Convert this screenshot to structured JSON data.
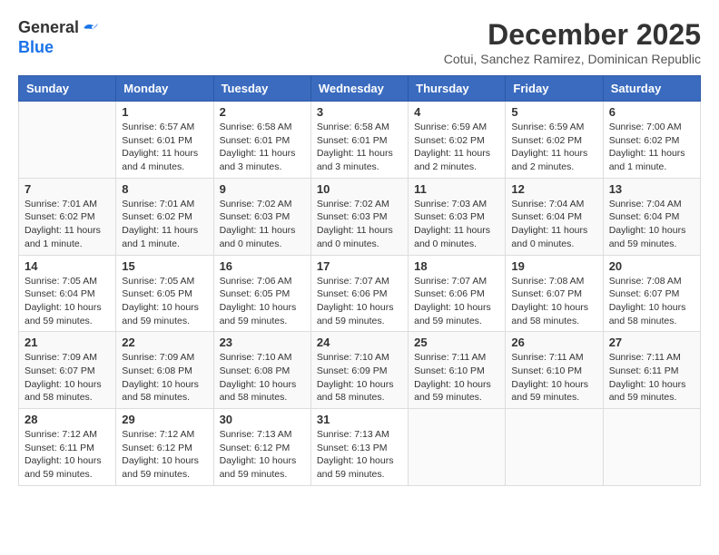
{
  "header": {
    "logo_line1": "General",
    "logo_line2": "Blue",
    "month_title": "December 2025",
    "subtitle": "Cotui, Sanchez Ramirez, Dominican Republic"
  },
  "columns": [
    "Sunday",
    "Monday",
    "Tuesday",
    "Wednesday",
    "Thursday",
    "Friday",
    "Saturday"
  ],
  "weeks": [
    [
      {
        "day": "",
        "info": ""
      },
      {
        "day": "1",
        "info": "Sunrise: 6:57 AM\nSunset: 6:01 PM\nDaylight: 11 hours\nand 4 minutes."
      },
      {
        "day": "2",
        "info": "Sunrise: 6:58 AM\nSunset: 6:01 PM\nDaylight: 11 hours\nand 3 minutes."
      },
      {
        "day": "3",
        "info": "Sunrise: 6:58 AM\nSunset: 6:01 PM\nDaylight: 11 hours\nand 3 minutes."
      },
      {
        "day": "4",
        "info": "Sunrise: 6:59 AM\nSunset: 6:02 PM\nDaylight: 11 hours\nand 2 minutes."
      },
      {
        "day": "5",
        "info": "Sunrise: 6:59 AM\nSunset: 6:02 PM\nDaylight: 11 hours\nand 2 minutes."
      },
      {
        "day": "6",
        "info": "Sunrise: 7:00 AM\nSunset: 6:02 PM\nDaylight: 11 hours\nand 1 minute."
      }
    ],
    [
      {
        "day": "7",
        "info": "Sunrise: 7:01 AM\nSunset: 6:02 PM\nDaylight: 11 hours\nand 1 minute."
      },
      {
        "day": "8",
        "info": "Sunrise: 7:01 AM\nSunset: 6:02 PM\nDaylight: 11 hours\nand 1 minute."
      },
      {
        "day": "9",
        "info": "Sunrise: 7:02 AM\nSunset: 6:03 PM\nDaylight: 11 hours\nand 0 minutes."
      },
      {
        "day": "10",
        "info": "Sunrise: 7:02 AM\nSunset: 6:03 PM\nDaylight: 11 hours\nand 0 minutes."
      },
      {
        "day": "11",
        "info": "Sunrise: 7:03 AM\nSunset: 6:03 PM\nDaylight: 11 hours\nand 0 minutes."
      },
      {
        "day": "12",
        "info": "Sunrise: 7:04 AM\nSunset: 6:04 PM\nDaylight: 11 hours\nand 0 minutes."
      },
      {
        "day": "13",
        "info": "Sunrise: 7:04 AM\nSunset: 6:04 PM\nDaylight: 10 hours\nand 59 minutes."
      }
    ],
    [
      {
        "day": "14",
        "info": "Sunrise: 7:05 AM\nSunset: 6:04 PM\nDaylight: 10 hours\nand 59 minutes."
      },
      {
        "day": "15",
        "info": "Sunrise: 7:05 AM\nSunset: 6:05 PM\nDaylight: 10 hours\nand 59 minutes."
      },
      {
        "day": "16",
        "info": "Sunrise: 7:06 AM\nSunset: 6:05 PM\nDaylight: 10 hours\nand 59 minutes."
      },
      {
        "day": "17",
        "info": "Sunrise: 7:07 AM\nSunset: 6:06 PM\nDaylight: 10 hours\nand 59 minutes."
      },
      {
        "day": "18",
        "info": "Sunrise: 7:07 AM\nSunset: 6:06 PM\nDaylight: 10 hours\nand 59 minutes."
      },
      {
        "day": "19",
        "info": "Sunrise: 7:08 AM\nSunset: 6:07 PM\nDaylight: 10 hours\nand 58 minutes."
      },
      {
        "day": "20",
        "info": "Sunrise: 7:08 AM\nSunset: 6:07 PM\nDaylight: 10 hours\nand 58 minutes."
      }
    ],
    [
      {
        "day": "21",
        "info": "Sunrise: 7:09 AM\nSunset: 6:07 PM\nDaylight: 10 hours\nand 58 minutes."
      },
      {
        "day": "22",
        "info": "Sunrise: 7:09 AM\nSunset: 6:08 PM\nDaylight: 10 hours\nand 58 minutes."
      },
      {
        "day": "23",
        "info": "Sunrise: 7:10 AM\nSunset: 6:08 PM\nDaylight: 10 hours\nand 58 minutes."
      },
      {
        "day": "24",
        "info": "Sunrise: 7:10 AM\nSunset: 6:09 PM\nDaylight: 10 hours\nand 58 minutes."
      },
      {
        "day": "25",
        "info": "Sunrise: 7:11 AM\nSunset: 6:10 PM\nDaylight: 10 hours\nand 59 minutes."
      },
      {
        "day": "26",
        "info": "Sunrise: 7:11 AM\nSunset: 6:10 PM\nDaylight: 10 hours\nand 59 minutes."
      },
      {
        "day": "27",
        "info": "Sunrise: 7:11 AM\nSunset: 6:11 PM\nDaylight: 10 hours\nand 59 minutes."
      }
    ],
    [
      {
        "day": "28",
        "info": "Sunrise: 7:12 AM\nSunset: 6:11 PM\nDaylight: 10 hours\nand 59 minutes."
      },
      {
        "day": "29",
        "info": "Sunrise: 7:12 AM\nSunset: 6:12 PM\nDaylight: 10 hours\nand 59 minutes."
      },
      {
        "day": "30",
        "info": "Sunrise: 7:13 AM\nSunset: 6:12 PM\nDaylight: 10 hours\nand 59 minutes."
      },
      {
        "day": "31",
        "info": "Sunrise: 7:13 AM\nSunset: 6:13 PM\nDaylight: 10 hours\nand 59 minutes."
      },
      {
        "day": "",
        "info": ""
      },
      {
        "day": "",
        "info": ""
      },
      {
        "day": "",
        "info": ""
      }
    ]
  ]
}
